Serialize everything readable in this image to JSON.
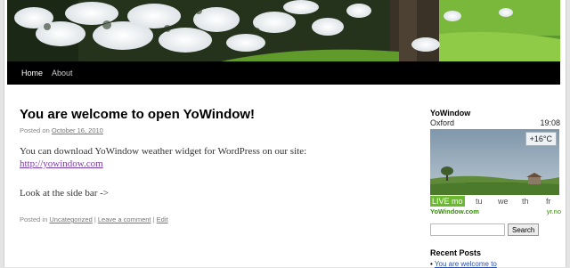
{
  "nav": {
    "items": [
      {
        "label": "Home",
        "active": true
      },
      {
        "label": "About",
        "active": false
      }
    ]
  },
  "post": {
    "title": "You are welcome to open YoWindow!",
    "meta_prefix": "Posted on",
    "date": "October 16, 2010",
    "body_line1": "You can download YoWindow weather widget for WordPress on our site:",
    "link": "http://yowindow.com",
    "body_line2": "Look at the side bar ->",
    "footer_prefix": "Posted in",
    "category": "Uncategorized",
    "sep": "|",
    "comment_link": "Leave a comment",
    "edit_link": "Edit"
  },
  "widget": {
    "title": "YoWindow",
    "city": "Oxford",
    "time": "19:08",
    "temperature": "+16°C",
    "tabs": [
      {
        "label": "LIVE mo",
        "live": true
      },
      {
        "label": "tu",
        "live": false
      },
      {
        "label": "we",
        "live": false
      },
      {
        "label": "th",
        "live": false
      },
      {
        "label": "fr",
        "live": false
      }
    ],
    "brand": "YoWindow.com",
    "yr": "yr.no"
  },
  "search": {
    "value": "",
    "button_label": "Search"
  },
  "recent": {
    "title": "Recent Posts",
    "bullet": "•",
    "items": [
      "You are welcome to"
    ]
  },
  "colors": {
    "nav_bg": "#000000",
    "link": "#7a3aa6",
    "live_tab": "#6ab92f",
    "brand_green": "#3a8a12"
  }
}
